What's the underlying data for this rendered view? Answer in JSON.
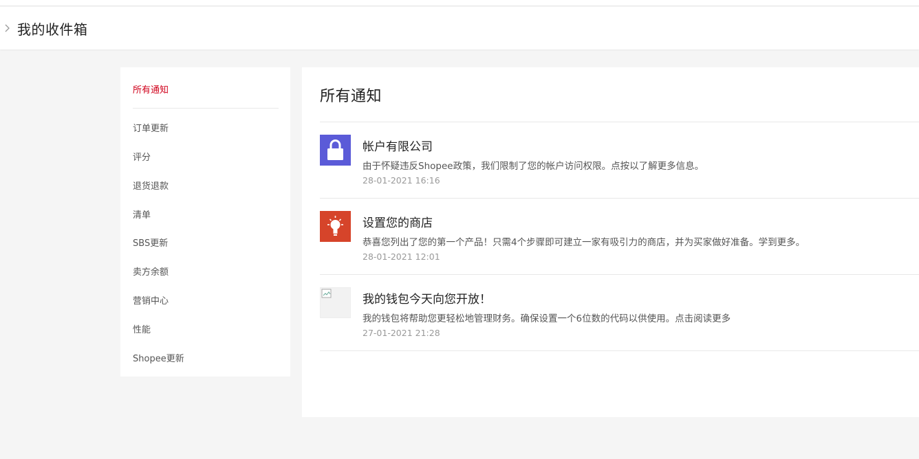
{
  "header": {
    "title": "我的收件箱"
  },
  "sidebar": {
    "items": [
      {
        "label": "所有通知"
      },
      {
        "label": "订单更新"
      },
      {
        "label": "评分"
      },
      {
        "label": "退货退款"
      },
      {
        "label": "清单"
      },
      {
        "label": "SBS更新"
      },
      {
        "label": "卖方余额"
      },
      {
        "label": "营销中心"
      },
      {
        "label": "性能"
      },
      {
        "label": "Shopee更新"
      }
    ]
  },
  "main": {
    "title": "所有通知",
    "notifications": [
      {
        "title": "帐户有限公司",
        "body": "由于怀疑违反Shopee政策，我们限制了您的帐户访问权限。点按以了解更多信息。",
        "time": "28-01-2021 16:16",
        "icon": "lock-icon"
      },
      {
        "title": "设置您的商店",
        "body": "恭喜您列出了您的第一个产品！只需4个步骤即可建立一家有吸引力的商店，并为买家做好准备。学到更多。",
        "time": "28-01-2021 12:01",
        "icon": "lightbulb-icon"
      },
      {
        "title": "我的钱包今天向您开放！",
        "body": "我的钱包将帮助您更轻松地管理财务。确保设置一个6位数的代码以供使用。点击阅读更多",
        "time": "27-01-2021 21:28",
        "icon": "broken-image-icon"
      }
    ]
  },
  "colors": {
    "accent": "#d0011b",
    "lock_bg": "#5b5bd8",
    "bulb_bg": "#d6442a"
  }
}
